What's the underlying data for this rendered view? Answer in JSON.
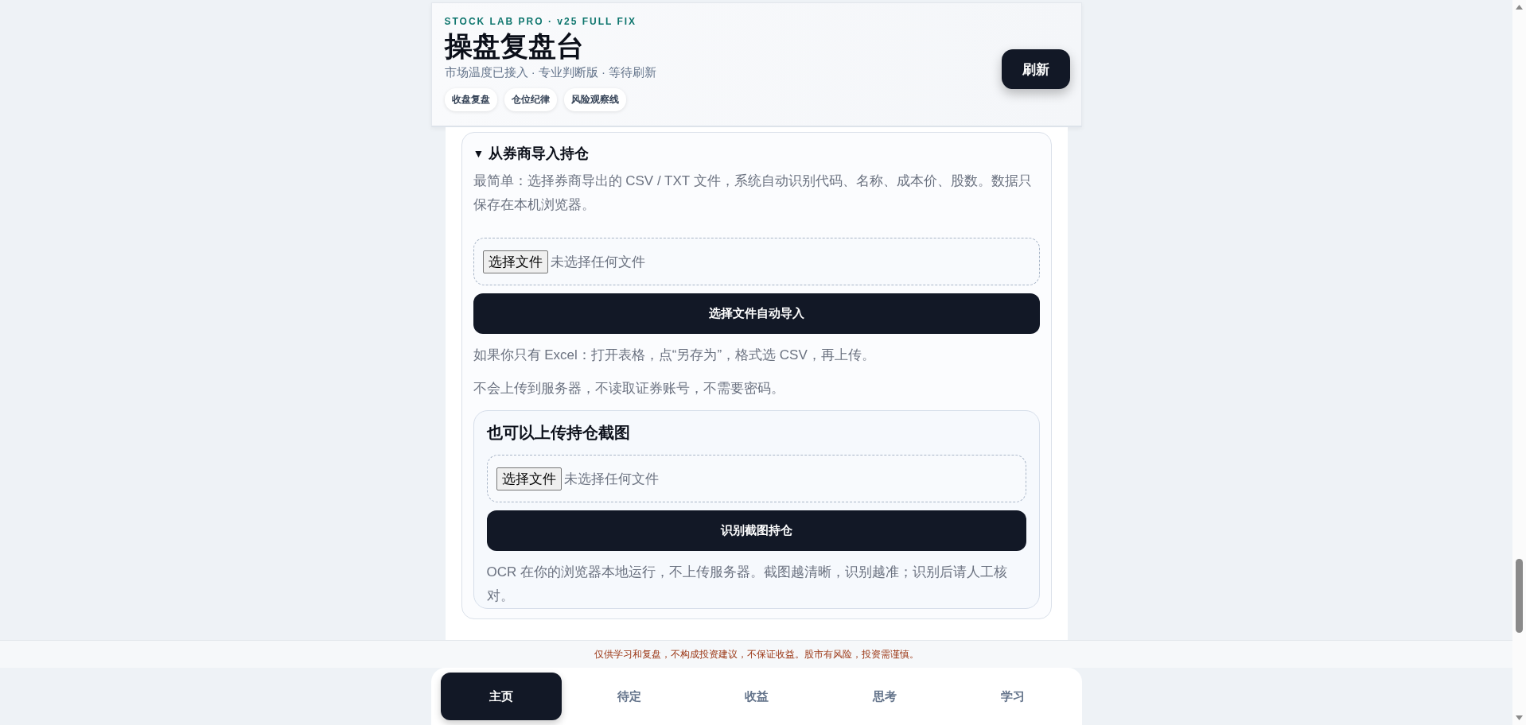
{
  "header": {
    "eyebrow": "STOCK LAB PRO · v25 FULL FIX",
    "title": "操盘复盘台",
    "subtitle": "市场温度已接入 · 专业判断版 · 等待刷新",
    "tags": [
      "收盘复盘",
      "仓位纪律",
      "风险观察线"
    ],
    "refresh_button": "刷新"
  },
  "import_section": {
    "toggle": "▼",
    "title": "从券商导入持仓",
    "intro": "最简单：选择券商导出的 CSV / TXT 文件，系统自动识别代码、名称、成本价、股数。数据只保存在本机浏览器。",
    "file_picker": {
      "button": "选择文件",
      "status": "未选择任何文件"
    },
    "import_button": "选择文件自动导入",
    "notes": [
      "如果你只有 Excel：打开表格，点“另存为”，格式选 CSV，再上传。",
      "不会上传到服务器，不读取证券账号，不需要密码。"
    ],
    "screenshot_panel": {
      "title": "也可以上传持仓截图",
      "file_picker": {
        "button": "选择文件",
        "status": "未选择任何文件"
      },
      "recognize_button": "识别截图持仓",
      "note": "OCR 在你的浏览器本地运行，不上传服务器。截图越清晰，识别越准；识别后请人工核对。"
    }
  },
  "disclaimer": "仅供学习和复盘，不构成投资建议，不保证收益。股市有风险，投资需谨慎。",
  "nav": [
    {
      "label": "主页",
      "selected": true
    },
    {
      "label": "待定",
      "selected": false
    },
    {
      "label": "收益",
      "selected": false
    },
    {
      "label": "思考",
      "selected": false
    },
    {
      "label": "学习",
      "selected": false
    }
  ]
}
